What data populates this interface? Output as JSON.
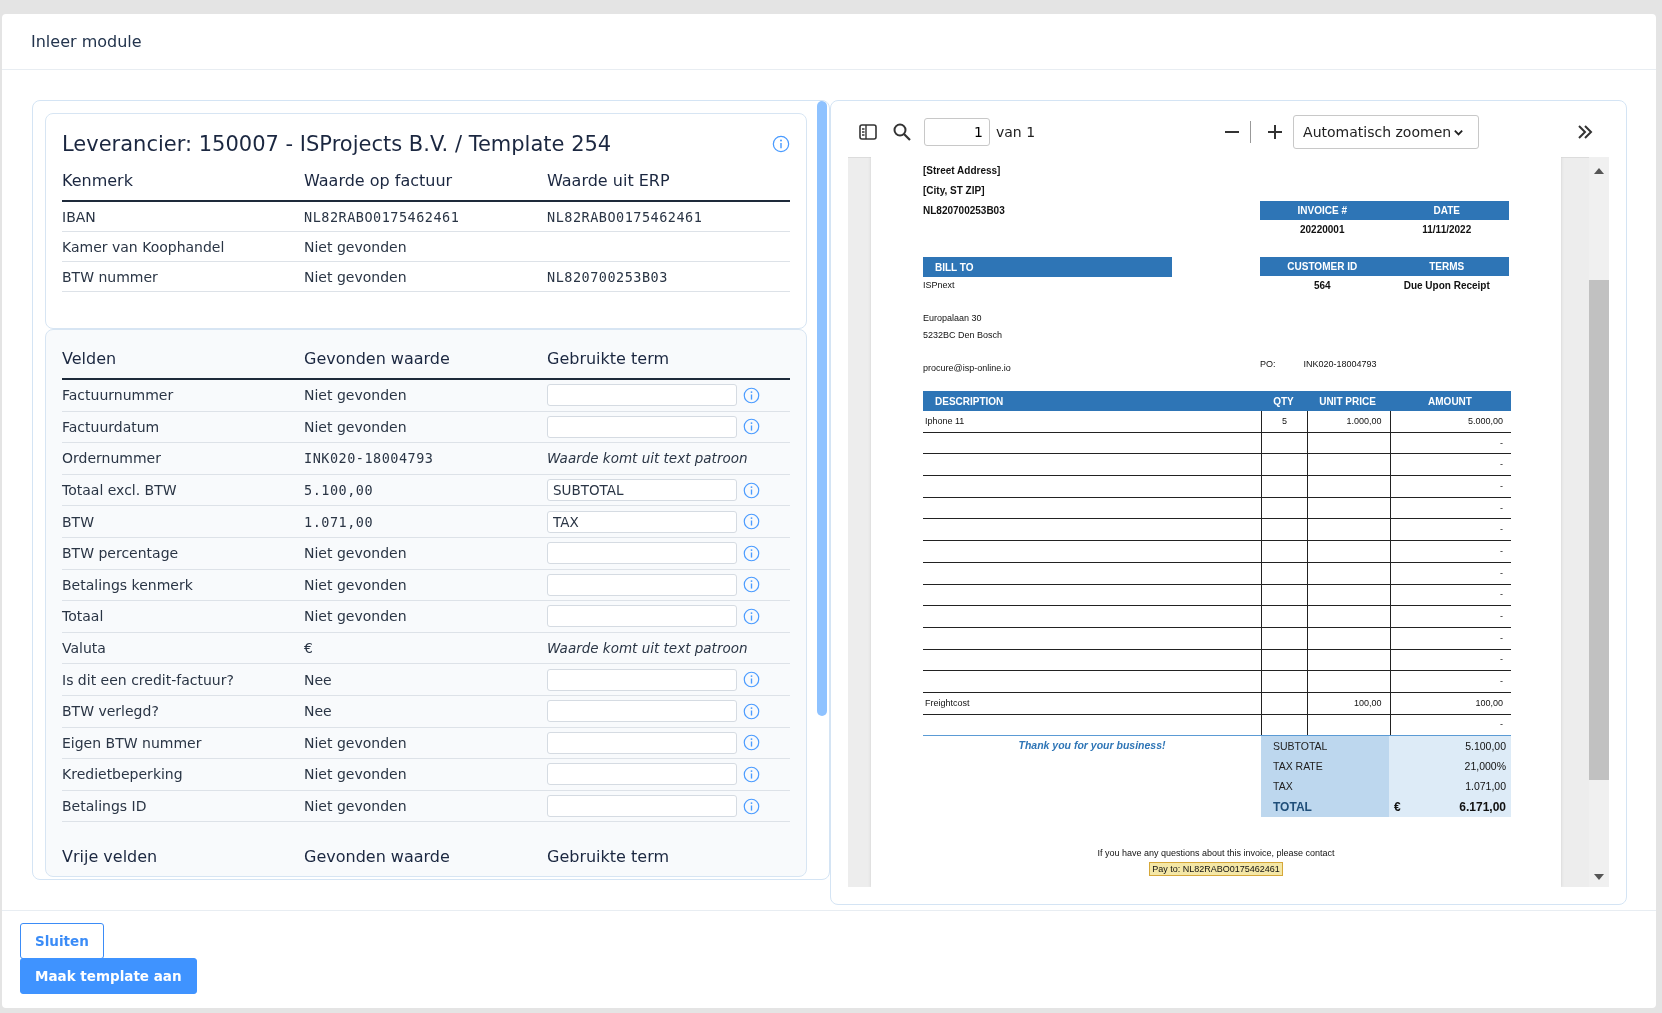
{
  "window": {
    "title": "Inleer module"
  },
  "supplier": {
    "title": "Leverancier: 150007 - ISProjects B.V. / Template 254",
    "columns": [
      "Kenmerk",
      "Waarde op factuur",
      "Waarde uit ERP"
    ],
    "rows": [
      {
        "label": "IBAN",
        "invoice_value": {
          "text": "NL82RABO0175462461",
          "code": true
        },
        "erp_value": {
          "text": "NL82RABO0175462461",
          "code": true
        }
      },
      {
        "label": "Kamer van Koophandel",
        "invoice_value": {
          "text": "Niet gevonden",
          "code": false
        }
      },
      {
        "label": "BTW nummer",
        "invoice_value": {
          "text": "Niet gevonden",
          "code": false
        },
        "erp_value": {
          "text": "NL820700253B03",
          "code": true
        }
      }
    ]
  },
  "fields": {
    "columns": [
      "Velden",
      "Gevonden waarde",
      "Gebruikte term"
    ],
    "rows": [
      {
        "label": "Factuurnummer",
        "found": {
          "text": "Niet gevonden",
          "code": false
        },
        "kind": "input"
      },
      {
        "label": "Factuurdatum",
        "found": {
          "text": "Niet gevonden",
          "code": false
        },
        "kind": "input"
      },
      {
        "label": "Ordernummer",
        "found": {
          "text": "INK020-18004793",
          "code": true
        },
        "kind": "pattern",
        "term": "Waarde komt uit text patroon"
      },
      {
        "label": "Totaal excl. BTW",
        "found": {
          "text": "5.100,00",
          "code": true
        },
        "kind": "input",
        "term": "SUBTOTAL"
      },
      {
        "label": "BTW",
        "found": {
          "text": "1.071,00",
          "code": true
        },
        "kind": "input",
        "term": "TAX"
      },
      {
        "label": "BTW percentage",
        "found": {
          "text": "Niet gevonden",
          "code": false
        },
        "kind": "input"
      },
      {
        "label": "Betalings kenmerk",
        "found": {
          "text": "Niet gevonden",
          "code": false
        },
        "kind": "input"
      },
      {
        "label": "Totaal",
        "found": {
          "text": "Niet gevonden",
          "code": false
        },
        "kind": "input"
      },
      {
        "label": "Valuta",
        "found": {
          "text": "€",
          "code": false
        },
        "kind": "pattern",
        "term": "Waarde komt uit text patroon"
      },
      {
        "label": "Is dit een credit-factuur?",
        "found": {
          "text": "Nee",
          "code": false
        },
        "kind": "input"
      },
      {
        "label": "BTW verlegd?",
        "found": {
          "text": "Nee",
          "code": false
        },
        "kind": "input"
      },
      {
        "label": "Eigen BTW nummer",
        "found": {
          "text": "Niet gevonden",
          "code": false
        },
        "kind": "input"
      },
      {
        "label": "Kredietbeperking",
        "found": {
          "text": "Niet gevonden",
          "code": false
        },
        "kind": "input"
      },
      {
        "label": "Betalings ID",
        "found": {
          "text": "Niet gevonden",
          "code": false
        },
        "kind": "input"
      }
    ]
  },
  "free_fields": {
    "columns": [
      "Vrije velden",
      "Gevonden waarde",
      "Gebruikte term"
    ]
  },
  "viewer": {
    "page": "1",
    "page_count": "van 1",
    "zoom": "Automatisch zoomen",
    "invoice": {
      "address": [
        "[Street Address]",
        "[City, ST  ZIP]",
        "NL820700253B03"
      ],
      "meta": [
        {
          "columns": [
            "INVOICE #",
            "DATE"
          ],
          "values": [
            "20220001",
            "11/11/2022"
          ]
        },
        {
          "columns": [
            "CUSTOMER ID",
            "TERMS"
          ],
          "values": [
            "564",
            "Due Upon Receipt"
          ]
        }
      ],
      "bill_to": {
        "heading": "BILL TO",
        "groups": [
          [
            "ISPnext"
          ],
          [
            "Europalaan 30",
            "5232BC Den Bosch"
          ],
          [
            "procure@isp-online.io"
          ]
        ]
      },
      "po": {
        "label": "PO:",
        "value": "INK020-18004793"
      },
      "items": {
        "columns": [
          "DESCRIPTION",
          "QTY",
          "UNIT PRICE",
          "AMOUNT"
        ],
        "rows": [
          {
            "description": "Iphone 11",
            "qty": "5",
            "unit_price": "1.000,00",
            "amount": "5.000,00"
          },
          {
            "amount": "-"
          },
          {
            "amount": "-"
          },
          {
            "amount": "-"
          },
          {
            "amount": "-"
          },
          {
            "amount": "-"
          },
          {
            "amount": "-"
          },
          {
            "amount": "-"
          },
          {
            "amount": "-"
          },
          {
            "amount": "-"
          },
          {
            "amount": "-"
          },
          {
            "amount": "-"
          },
          {
            "amount": "-"
          },
          {
            "description": "Freightcost",
            "unit_price": "100,00",
            "amount": "100,00"
          },
          {
            "amount": "-"
          }
        ]
      },
      "thanks": "Thank you for your business!",
      "totals": [
        {
          "label": "SUBTOTAL",
          "value": "5.100,00",
          "kind": "line"
        },
        {
          "label": "TAX RATE",
          "value": "21,000%",
          "kind": "line"
        },
        {
          "label": "TAX",
          "value": "1.071,00",
          "kind": "line"
        },
        {
          "label": "TOTAL",
          "currency": "€",
          "value": "6.171,00",
          "kind": "grand"
        }
      ],
      "contact": "If you have any questions about this invoice, please contact",
      "pay_to": {
        "text": "Pay to: NL82RABO0175462461",
        "highlighted": true
      }
    }
  },
  "buttons": [
    {
      "label": "Sluiten",
      "kind": "secondary"
    },
    {
      "label": "Maak template aan",
      "kind": "primary"
    }
  ]
}
